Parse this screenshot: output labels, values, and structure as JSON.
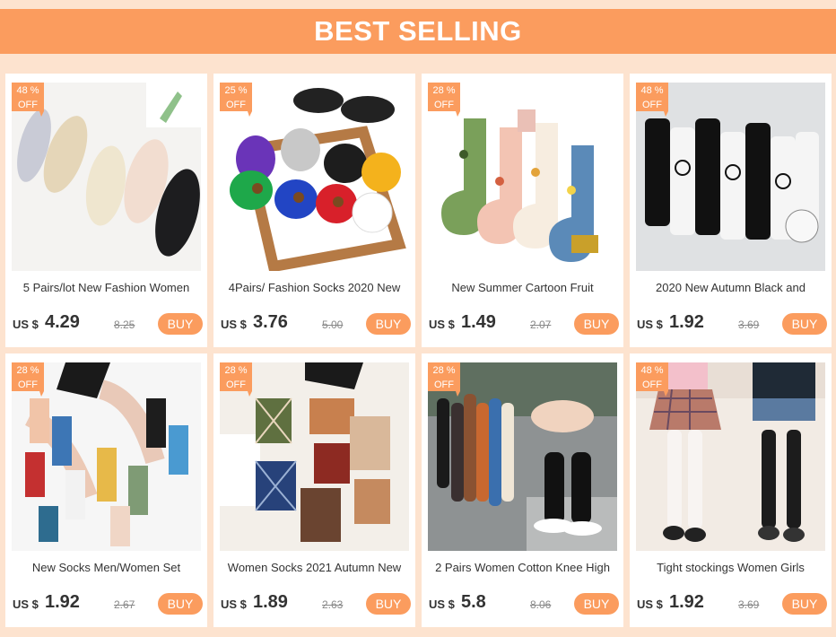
{
  "banner": {
    "title": "BEST SELLING"
  },
  "badge_off": "OFF",
  "currency": "US $",
  "buy_label": "BUY",
  "products": [
    {
      "discount": "48 %",
      "title": "5 Pairs/lot New Fashion Women",
      "price": "4.29",
      "old_price": "8.25",
      "image": "lace-no-show-socks"
    },
    {
      "discount": "25 %",
      "title": "4Pairs/ Fashion Socks 2020 New",
      "price": "3.76",
      "old_price": "5.00",
      "image": "emoji-ankle-socks"
    },
    {
      "discount": "28 %",
      "title": "New Summer Cartoon Fruit",
      "price": "1.49",
      "old_price": "2.07",
      "image": "fruit-pattern-socks"
    },
    {
      "discount": "48 %",
      "title": "2020 New Autumn Black and",
      "price": "1.92",
      "old_price": "3.69",
      "image": "black-white-cartoon-socks"
    },
    {
      "discount": "28 %",
      "title": "New Socks Men/Women Set",
      "price": "1.92",
      "old_price": "2.67",
      "image": "art-print-socks"
    },
    {
      "discount": "28 %",
      "title": "Women Socks 2021 Autumn New",
      "price": "1.89",
      "old_price": "2.63",
      "image": "argyle-socks"
    },
    {
      "discount": "28 %",
      "title": "2 Pairs Women Cotton Knee High",
      "price": "5.8",
      "old_price": "8.06",
      "image": "knee-high-socks"
    },
    {
      "discount": "48 %",
      "title": "Tight stockings Women Girls",
      "price": "1.92",
      "old_price": "3.69",
      "image": "thigh-high-stockings"
    }
  ],
  "colors": {
    "accent": "#fb9c5e",
    "background": "#fde3cf",
    "card": "#ffffff",
    "text": "#333333"
  }
}
